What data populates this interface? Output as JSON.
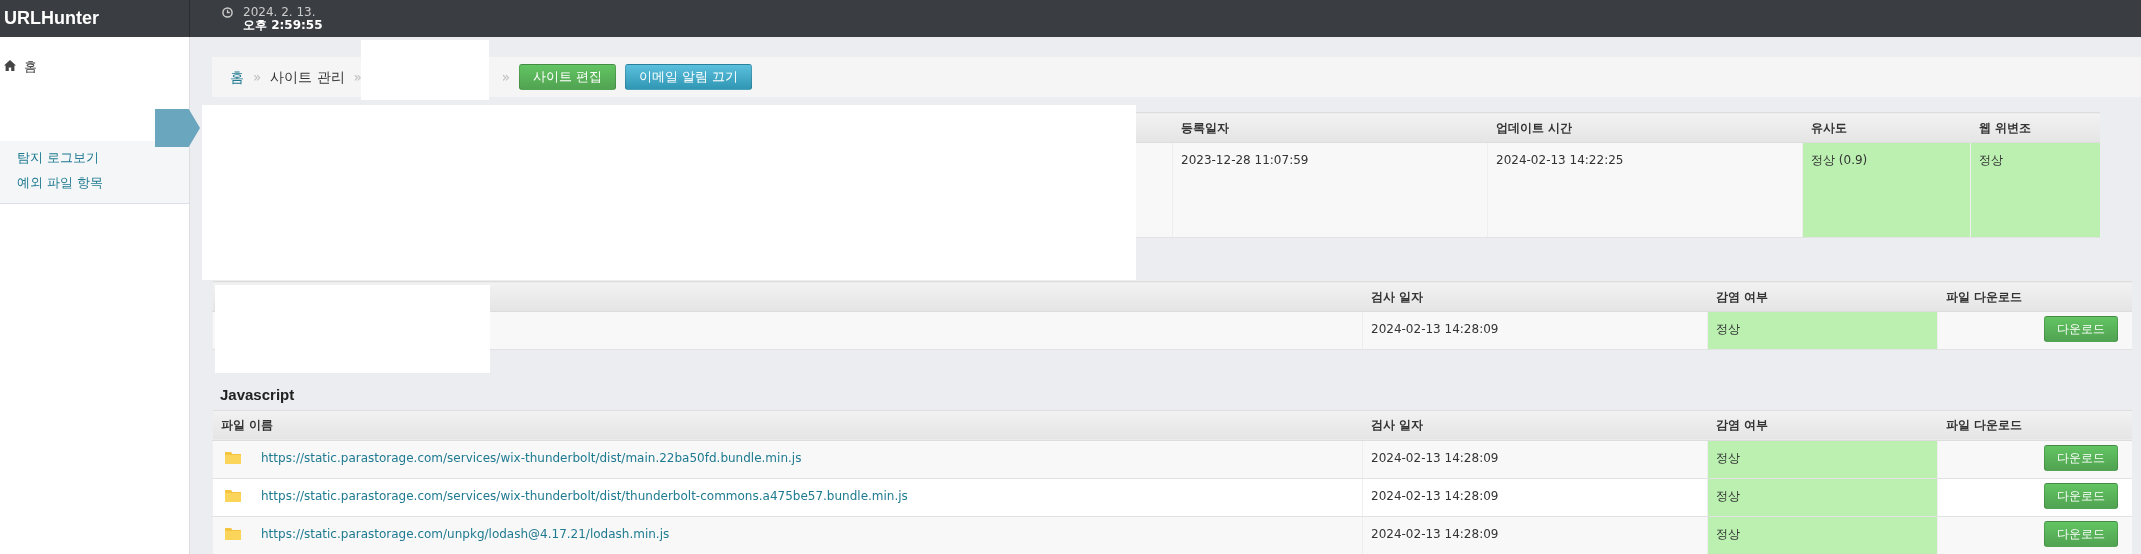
{
  "app": {
    "title": "URLHunter"
  },
  "clock": {
    "date": "2024. 2. 13.",
    "time": "오후 2:59:55"
  },
  "sidebar": {
    "home": "홈",
    "items": [
      {
        "label": "탐지 로그보기"
      },
      {
        "label": "예외 파일 항목"
      }
    ]
  },
  "breadcrumb": {
    "items": [
      "홈",
      "사이트 관리"
    ],
    "separators": [
      "»",
      "»",
      "»"
    ],
    "buttons": [
      {
        "label": "사이트 편집",
        "kind": "success"
      },
      {
        "label": "이메일 알림 끄기",
        "kind": "info"
      }
    ]
  },
  "site_table": {
    "columns": [
      "등록일자",
      "업데이트 시간",
      "유사도",
      "웹 위변조"
    ],
    "rows": [
      {
        "cells": [
          {
            "text": "2023-12-28 11:07:59",
            "ok": false
          },
          {
            "text": "2024-02-13 14:22:25",
            "ok": false
          },
          {
            "text": "정상 (0.9)",
            "ok": true
          },
          {
            "text": "정상",
            "ok": true
          }
        ]
      }
    ]
  },
  "page_table": {
    "columns": [
      "검사 일자",
      "감염 여부",
      "파일 다운로드"
    ],
    "rows": [
      {
        "date": "2024-02-13 14:28:09",
        "status": "정상",
        "ok": true,
        "button": "다운로드"
      }
    ]
  },
  "javascript": {
    "title": "Javascript",
    "columns": [
      "파일 이름",
      "검사 일자",
      "감염 여부",
      "파일 다운로드"
    ],
    "rows": [
      {
        "file": "https://static.parastorage.com/services/wix-thunderbolt/dist/main.22ba50fd.bundle.min.js",
        "date": "2024-02-13 14:28:09",
        "status": "정상",
        "ok": true,
        "button": "다운로드"
      },
      {
        "file": "https://static.parastorage.com/services/wix-thunderbolt/dist/thunderbolt-commons.a475be57.bundle.min.js",
        "date": "2024-02-13 14:28:09",
        "status": "정상",
        "ok": true,
        "button": "다운로드"
      },
      {
        "file": "https://static.parastorage.com/unpkg/lodash@4.17.21/lodash.min.js",
        "date": "2024-02-13 14:28:09",
        "status": "정상",
        "ok": true,
        "button": "다운로드"
      }
    ]
  }
}
